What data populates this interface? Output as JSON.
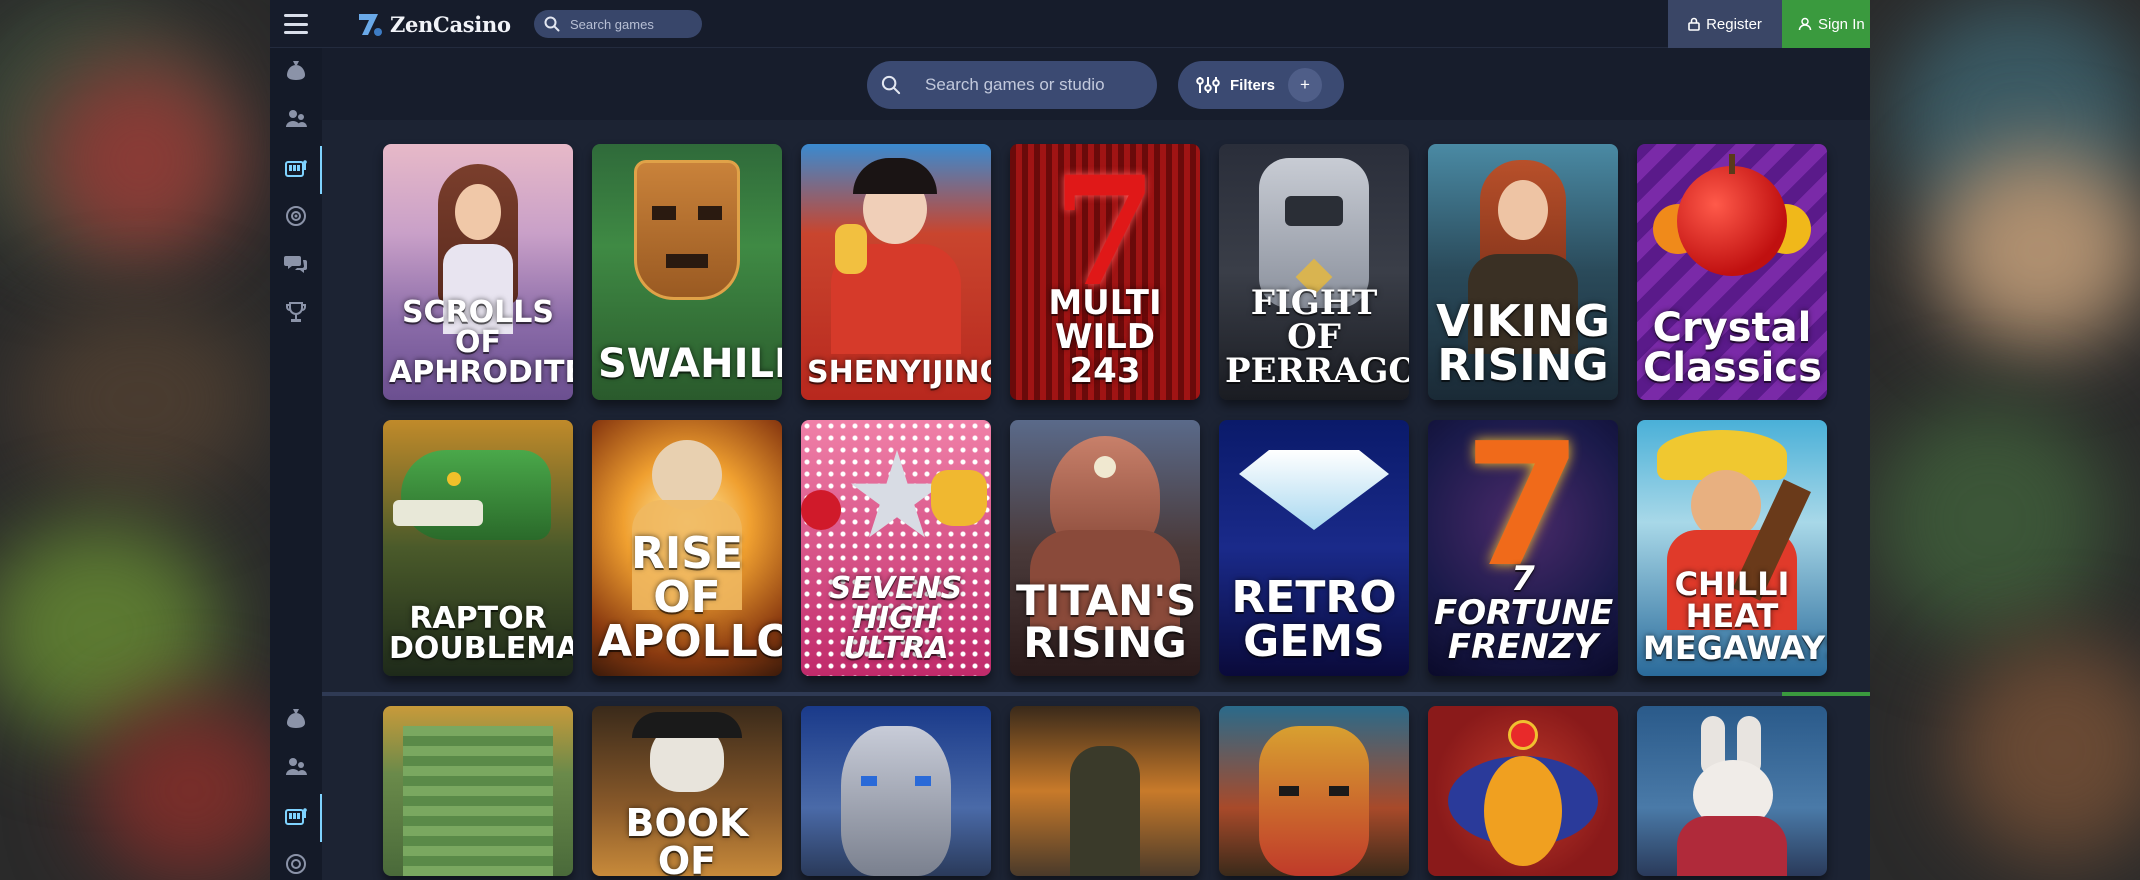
{
  "brand": {
    "name": "ZenCasino"
  },
  "header": {
    "search_placeholder": "Search games",
    "register_label": "Register",
    "signin_label": "Sign In"
  },
  "filters": {
    "search_placeholder": "Search games or studio",
    "filters_label": "Filters",
    "add_label": "+"
  },
  "sidebar": {
    "items": [
      {
        "icon": "money-bag-icon"
      },
      {
        "icon": "users-icon"
      },
      {
        "icon": "slot-machine-icon",
        "active": true
      },
      {
        "icon": "roulette-icon"
      },
      {
        "icon": "chat-icon"
      },
      {
        "icon": "trophy-icon"
      }
    ]
  },
  "games": [
    {
      "title": "SCROLLS OF APHRODITE",
      "line1": "SCROLLS OF",
      "line2": "APHRODITE"
    },
    {
      "title": "SWAHILI",
      "line1": "",
      "line2": "SWAHILI"
    },
    {
      "title": "SHENYIJING",
      "line1": "",
      "line2": "SHENYIJING"
    },
    {
      "title": "MULTI WILD 243",
      "line1": "MULTI WILD",
      "line2": "243"
    },
    {
      "title": "FIGHT OF PERRAGON",
      "line1": "FIGHT OF",
      "line2": "PERRAGON"
    },
    {
      "title": "VIKING RISING",
      "line1": "VIKING",
      "line2": "RISING"
    },
    {
      "title": "Crystal Classics",
      "line1": "Crystal",
      "line2": "Classics"
    },
    {
      "title": "RAPTOR DOUBLEMAX",
      "line1": "RAPTOR",
      "line2": "DOUBLEMAX"
    },
    {
      "title": "RISE OF APOLLO",
      "line1": "RISE OF",
      "line2": "APOLLO"
    },
    {
      "title": "SEVENS HIGH ULTRA",
      "line1": "SEVENS HIGH",
      "line2": "ULTRA"
    },
    {
      "title": "TITAN'S RISING",
      "line1": "TITAN'S",
      "line2": "RISING"
    },
    {
      "title": "RETRO GEMS",
      "line1": "RETRO",
      "line2": "GEMS"
    },
    {
      "title": "7 FORTUNE FRENZY",
      "line1": "7 FORTUNE",
      "line2": "FRENZY"
    },
    {
      "title": "CHILLI HEAT MEGAWAYS",
      "line1": "CHILLI HEAT",
      "line2": "MEGAWAYS"
    }
  ],
  "lower_games": [
    {
      "title": "BOOK OF CAPTAIN",
      "line1": "BOOK OF"
    }
  ],
  "colors": {
    "accent_green": "#3a9a3e",
    "header_bg": "#161c2b",
    "search_bg": "#3b4a72",
    "active_indicator": "#7fd3ff"
  }
}
